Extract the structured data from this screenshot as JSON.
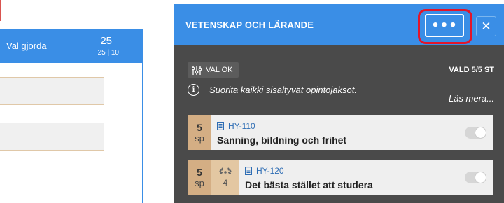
{
  "left_pane": {
    "header_title": "Val gjorda",
    "header_value": "25",
    "header_sub": "25 | 10"
  },
  "panel": {
    "title": "VETENSKAP OCH LÄRANDE",
    "more_label": "•••",
    "close_label": "✕",
    "val_ok_label": "VAL OK",
    "vald_label": "VALD 5/5 ST",
    "info_text": "Suorita kaikki sisältyvät opintojaksot.",
    "las_mera": "Läs mera...",
    "courses": [
      {
        "sp": "5",
        "sp_unit": "sp",
        "code": "HY-110",
        "name": "Sanning, bildning och frihet",
        "grade": null,
        "toggle_on": false
      },
      {
        "sp": "5",
        "sp_unit": "sp",
        "code": "HY-120",
        "name": "Det bästa stället att studera",
        "grade": "4",
        "toggle_on": false
      }
    ]
  },
  "icons": {
    "more": "more-dots-icon",
    "close": "close-icon",
    "filters": "sliders-icon",
    "info": "info-icon",
    "document": "document-icon",
    "laurel": "laurel-icon"
  },
  "colors": {
    "header_blue": "#3a8ee6",
    "panel_dark": "#4a4a4a",
    "highlight_red": "#e2152a",
    "sp_tan": "#d4ae84",
    "grade_tan": "#e3c7a2",
    "code_blue": "#2e6db4"
  }
}
